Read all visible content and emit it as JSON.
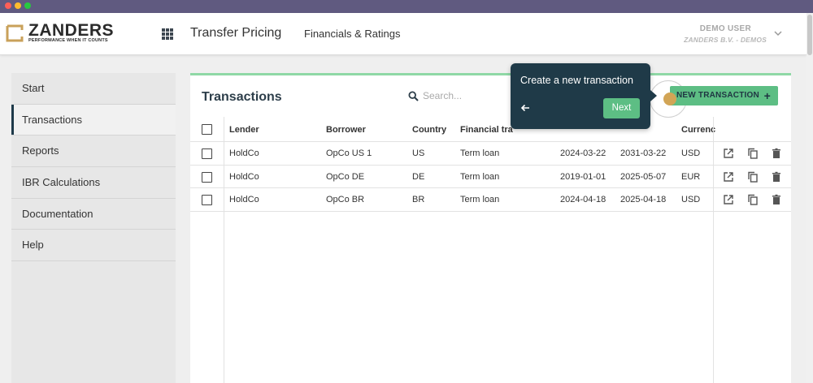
{
  "brand": {
    "name": "ZANDERS",
    "tagline": "PERFORMANCE WHEN IT COUNTS",
    "color": "#c9a15a"
  },
  "header": {
    "title": "Transfer Pricing",
    "nav_link": "Financials & Ratings",
    "user_name": "DEMO USER",
    "user_org": "ZANDERS B.V. - DEMOS"
  },
  "sidebar": {
    "items": [
      {
        "label": "Start"
      },
      {
        "label": "Transactions"
      },
      {
        "label": "Reports"
      },
      {
        "label": "IBR Calculations"
      },
      {
        "label": "Documentation"
      },
      {
        "label": "Help"
      }
    ]
  },
  "main": {
    "title": "Transactions",
    "search_placeholder": "Search...",
    "new_button": "NEW TRANSACTION",
    "new_button_icon": "+",
    "accent": "#5dbe84",
    "columns": [
      "Lender",
      "Borrower",
      "Country",
      "Financial tra",
      "Currenc"
    ],
    "rows": [
      {
        "lender": "HoldCo",
        "borrower": "OpCo US 1",
        "country": "US",
        "type": "Term loan",
        "start": "2024-03-22",
        "end": "2031-03-22",
        "currency": "USD"
      },
      {
        "lender": "HoldCo",
        "borrower": "OpCo DE",
        "country": "DE",
        "type": "Term loan",
        "start": "2019-01-01",
        "end": "2025-05-07",
        "currency": "EUR"
      },
      {
        "lender": "HoldCo",
        "borrower": "OpCo BR",
        "country": "BR",
        "type": "Term loan",
        "start": "2024-04-18",
        "end": "2025-04-18",
        "currency": "USD"
      }
    ]
  },
  "tour": {
    "text": "Create a new transaction",
    "next": "Next",
    "back_icon": "arrow-left-icon"
  }
}
